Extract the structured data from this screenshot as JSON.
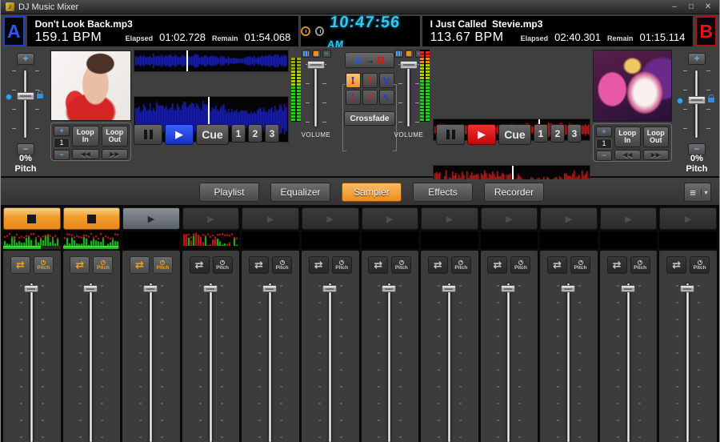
{
  "window": {
    "title": "DJ Music Mixer",
    "minimize": "–",
    "maximize": "□",
    "close": "✕"
  },
  "clock": {
    "time": "10:47:56",
    "ampm": "AM"
  },
  "labels": {
    "elapsed": "Elapsed",
    "remain": "Remain",
    "cue": "Cue",
    "hot_cues": [
      "1",
      "2",
      "3"
    ],
    "loop_in": "Loop In",
    "loop_out": "Loop Out",
    "rewind_icon": "◀◀",
    "forward_icon": "▶▶",
    "plus": "+",
    "minus": "−",
    "volume": "VOLUME",
    "crossfade": "Crossfade",
    "ab_a": "A",
    "ab_arrow": "→",
    "ab_b": "B",
    "pitch": "Pitch",
    "list_icon": "≡",
    "caret_icon": "▾"
  },
  "decks": {
    "a": {
      "badge": "A",
      "track": "Don't Look Back.mp3",
      "bpm": "159.1 BPM",
      "elapsed": "01:02.728",
      "remain": "01:54.068",
      "pitch_value": "0%",
      "loop_count": "1",
      "overview_pos": 0.34,
      "detail_pos": 0.48,
      "vu_level": 1.0
    },
    "b": {
      "badge": "B",
      "track": "I Just Called  Stevie.mp3",
      "bpm": "113.67 BPM",
      "elapsed": "02:40.301",
      "remain": "01:15.114",
      "pitch_value": "0%",
      "loop_count": "1",
      "overview_pos": 0.67,
      "detail_pos": 0.5,
      "vu_level": 1.0
    }
  },
  "mixer": {
    "curves": [
      {
        "icon": "cross-x",
        "active": true
      },
      {
        "icon": "t-curve",
        "active": false
      },
      {
        "icon": "v-curve",
        "active": false
      },
      {
        "icon": "cross-x2",
        "active": false
      },
      {
        "icon": "ramp-up",
        "active": false
      },
      {
        "icon": "ramp-down",
        "active": false
      }
    ]
  },
  "tabs": [
    {
      "label": "Playlist",
      "active": false
    },
    {
      "label": "Equalizer",
      "active": false
    },
    {
      "label": "Sampler",
      "active": true
    },
    {
      "label": "Effects",
      "active": false
    },
    {
      "label": "Recorder",
      "active": false
    }
  ],
  "sampler": {
    "pitch_label": "Pitch",
    "channels": [
      {
        "button": "stop",
        "tone": "orange",
        "spectrum": true,
        "progress": 0.66,
        "controls": "orange"
      },
      {
        "button": "stop",
        "tone": "orange",
        "spectrum": true,
        "progress": 0.97,
        "controls": "orange"
      },
      {
        "button": "play",
        "tone": "lit",
        "spectrum": false,
        "progress": null,
        "controls": "orange"
      },
      {
        "button": "play",
        "tone": "dim",
        "spectrum": true,
        "progress": null,
        "controls": "dim"
      },
      {
        "button": "play",
        "tone": "dim",
        "spectrum": false,
        "progress": null,
        "controls": "dim"
      },
      {
        "button": "play",
        "tone": "dim",
        "spectrum": false,
        "progress": null,
        "controls": "dim"
      },
      {
        "button": "play",
        "tone": "dim",
        "spectrum": false,
        "progress": null,
        "controls": "dim"
      },
      {
        "button": "play",
        "tone": "dim",
        "spectrum": false,
        "progress": null,
        "controls": "dim"
      },
      {
        "button": "play",
        "tone": "dim",
        "spectrum": false,
        "progress": null,
        "controls": "dim"
      },
      {
        "button": "play",
        "tone": "dim",
        "spectrum": false,
        "progress": null,
        "controls": "dim"
      },
      {
        "button": "play",
        "tone": "dim",
        "spectrum": false,
        "progress": null,
        "controls": "dim"
      },
      {
        "button": "play",
        "tone": "dim",
        "spectrum": false,
        "progress": null,
        "controls": "dim"
      }
    ]
  },
  "colors": {
    "accent_a": "#2f55f0",
    "accent_b": "#e81414",
    "wave_a": "#1a1ae8",
    "wave_b": "#e81212",
    "lcd": "#32c8f0",
    "tab_active": "#ee8c1c",
    "progress_green": "#22cc22"
  }
}
